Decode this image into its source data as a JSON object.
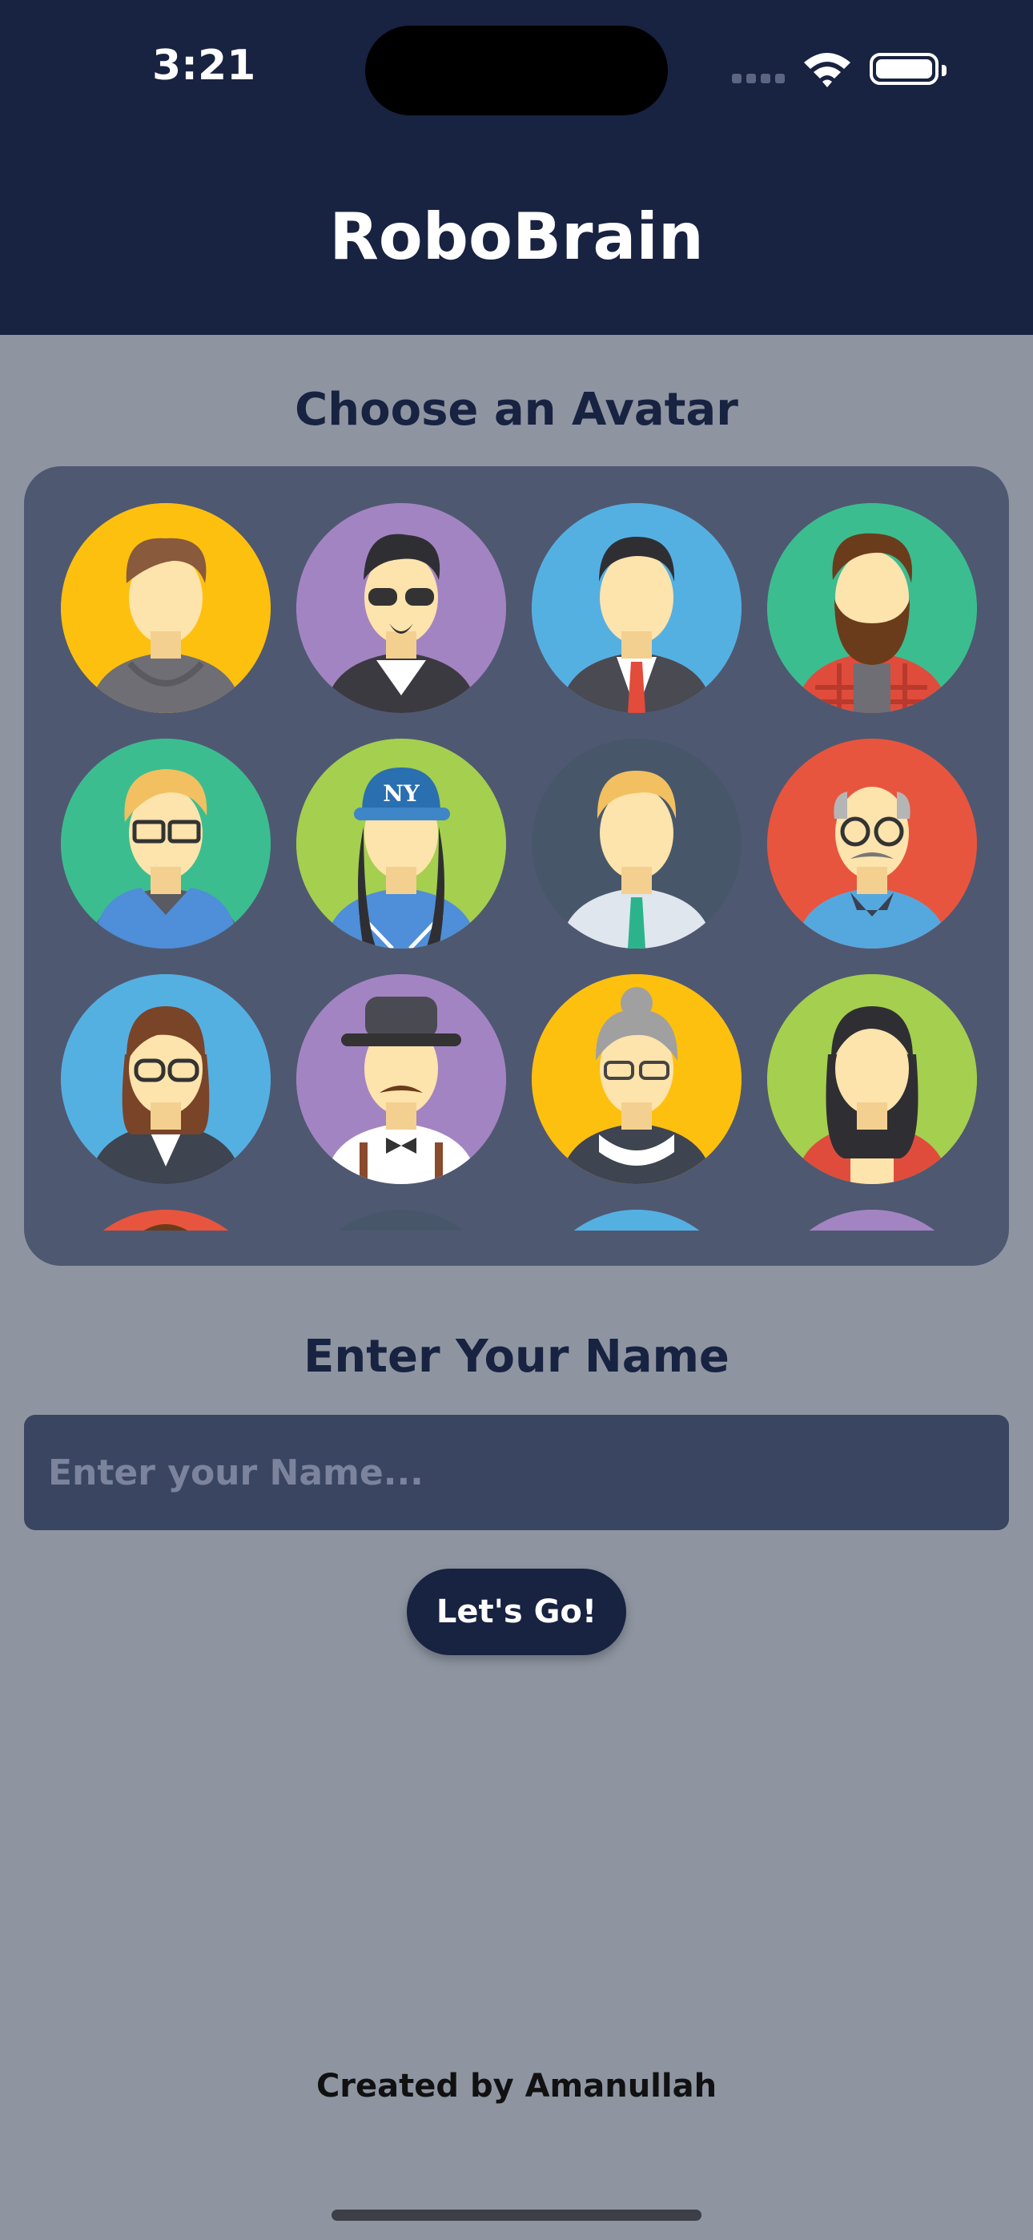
{
  "status_bar": {
    "time": "3:21"
  },
  "header": {
    "title": "RoboBrain"
  },
  "avatar_section": {
    "title": "Choose an Avatar",
    "avatars": [
      {
        "name": "avatar-hoodie-man",
        "bg": "#fdc00f"
      },
      {
        "name": "avatar-sunglasses-biker",
        "bg": "#a384c2"
      },
      {
        "name": "avatar-businessman",
        "bg": "#55b0e2"
      },
      {
        "name": "avatar-bearded-man",
        "bg": "#3cbd90"
      },
      {
        "name": "avatar-nerd-glasses",
        "bg": "#3cbd90"
      },
      {
        "name": "avatar-ny-cap",
        "bg": "#a5cf4e"
      },
      {
        "name": "avatar-blond-tie",
        "bg": "#475769"
      },
      {
        "name": "avatar-old-man",
        "bg": "#e8553e"
      },
      {
        "name": "avatar-woman-glasses",
        "bg": "#55b0e2"
      },
      {
        "name": "avatar-hat-mustache",
        "bg": "#a384c2"
      },
      {
        "name": "avatar-grandma",
        "bg": "#fdc00f"
      },
      {
        "name": "avatar-woman-dark-hair",
        "bg": "#a5cf4e"
      },
      {
        "name": "avatar-partial-1",
        "bg": "#e8553e"
      },
      {
        "name": "avatar-partial-2",
        "bg": "#475769"
      },
      {
        "name": "avatar-partial-3",
        "bg": "#55b0e2"
      },
      {
        "name": "avatar-partial-4",
        "bg": "#a384c2"
      }
    ],
    "cap_text": "NY"
  },
  "name_section": {
    "title": "Enter Your Name",
    "placeholder": "Enter your Name...",
    "value": ""
  },
  "actions": {
    "go_label": "Let's Go!"
  },
  "footer": {
    "credit": "Created by Amanullah"
  },
  "colors": {
    "header_bg": "#182241",
    "page_bg": "#8e95a1",
    "card_bg": "#4f5871",
    "input_bg": "#3a4562"
  }
}
